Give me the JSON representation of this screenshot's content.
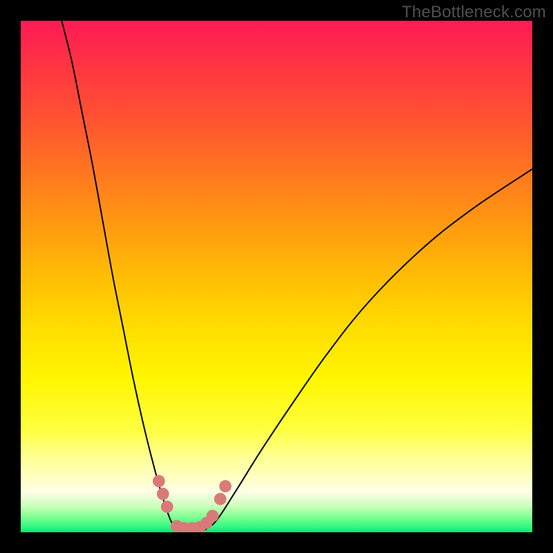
{
  "watermark": "TheBottleneck.com",
  "chart_data": {
    "type": "line",
    "title": "",
    "xlabel": "",
    "ylabel": "",
    "xlim": [
      0,
      100
    ],
    "ylim": [
      0,
      100
    ],
    "grid": false,
    "color_bands": [
      {
        "y": 100,
        "color": "#ff1a55"
      },
      {
        "y": 90,
        "color": "#ff3840"
      },
      {
        "y": 80,
        "color": "#ff5530"
      },
      {
        "y": 70,
        "color": "#ff7820"
      },
      {
        "y": 60,
        "color": "#ff9a10"
      },
      {
        "y": 50,
        "color": "#ffbd05"
      },
      {
        "y": 40,
        "color": "#ffdd00"
      },
      {
        "y": 30,
        "color": "#fff600"
      },
      {
        "y": 20,
        "color": "#ffff40"
      },
      {
        "y": 15,
        "color": "#ffff90"
      },
      {
        "y": 10,
        "color": "#ffffcc"
      },
      {
        "y": 8,
        "color": "#ffffe8"
      },
      {
        "y": 5,
        "color": "#c8ffb8"
      },
      {
        "y": 3,
        "color": "#80ff90"
      },
      {
        "y": 1,
        "color": "#30f883"
      },
      {
        "y": 0,
        "color": "#00e878"
      }
    ],
    "series": [
      {
        "name": "left-curve",
        "color": "#000000",
        "points": [
          {
            "x": 8,
            "y": 100
          },
          {
            "x": 10,
            "y": 92
          },
          {
            "x": 12,
            "y": 82
          },
          {
            "x": 14,
            "y": 72
          },
          {
            "x": 16,
            "y": 61
          },
          {
            "x": 18,
            "y": 50
          },
          {
            "x": 20,
            "y": 40
          },
          {
            "x": 22,
            "y": 30
          },
          {
            "x": 24,
            "y": 21
          },
          {
            "x": 26,
            "y": 13
          },
          {
            "x": 28,
            "y": 6
          },
          {
            "x": 30,
            "y": 1
          },
          {
            "x": 32,
            "y": 0
          }
        ]
      },
      {
        "name": "right-curve",
        "color": "#000000",
        "points": [
          {
            "x": 35,
            "y": 0
          },
          {
            "x": 38,
            "y": 2
          },
          {
            "x": 42,
            "y": 8
          },
          {
            "x": 47,
            "y": 16
          },
          {
            "x": 53,
            "y": 25
          },
          {
            "x": 60,
            "y": 35
          },
          {
            "x": 68,
            "y": 45
          },
          {
            "x": 78,
            "y": 55
          },
          {
            "x": 88,
            "y": 63
          },
          {
            "x": 100,
            "y": 71
          }
        ]
      },
      {
        "name": "bottom-link",
        "color": "#000000",
        "points": [
          {
            "x": 32,
            "y": 0
          },
          {
            "x": 33,
            "y": 0.5
          },
          {
            "x": 34,
            "y": 0.5
          },
          {
            "x": 35,
            "y": 0
          }
        ]
      }
    ],
    "markers": {
      "name": "dot-markers",
      "color": "#d97a79",
      "radius": 1.2,
      "points": [
        {
          "x": 27.0,
          "y": 10.0
        },
        {
          "x": 27.8,
          "y": 7.5
        },
        {
          "x": 28.6,
          "y": 5.0
        },
        {
          "x": 30.5,
          "y": 1.2
        },
        {
          "x": 32.0,
          "y": 0.8
        },
        {
          "x": 33.5,
          "y": 0.8
        },
        {
          "x": 35.0,
          "y": 1.0
        },
        {
          "x": 36.3,
          "y": 1.8
        },
        {
          "x": 37.5,
          "y": 3.2
        },
        {
          "x": 39.0,
          "y": 6.5
        },
        {
          "x": 40.0,
          "y": 9.0
        }
      ]
    }
  }
}
